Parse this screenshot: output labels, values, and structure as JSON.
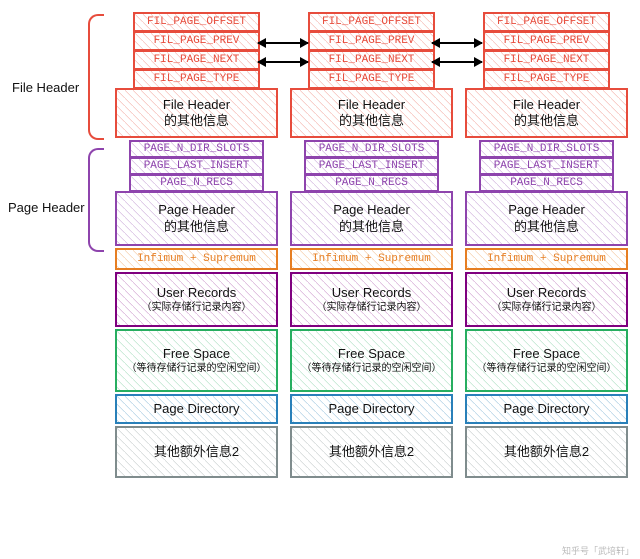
{
  "labels": {
    "file_header": "File Header",
    "page_header": "Page Header"
  },
  "file_header_fields": [
    "FIL_PAGE_OFFSET",
    "FIL_PAGE_PREV",
    "FIL_PAGE_NEXT",
    "FIL_PAGE_TYPE"
  ],
  "file_header_other": {
    "title": "File Header",
    "sub": "的其他信息"
  },
  "page_header_fields": [
    "PAGE_N_DIR_SLOTS",
    "PAGE_LAST_INSERT",
    "PAGE_N_RECS"
  ],
  "page_header_other": {
    "title": "Page Header",
    "sub": "的其他信息"
  },
  "infimum": "Infimum + Supremum",
  "user_records": {
    "title": "User Records",
    "sub": "（实际存储行记录内容）"
  },
  "free_space": {
    "title": "Free Space",
    "sub": "（等待存储行记录的空闲空间）"
  },
  "page_directory": "Page Directory",
  "other_info": "其他额外信息2",
  "watermark": "知乎号「武培轩」",
  "page_count": 3
}
